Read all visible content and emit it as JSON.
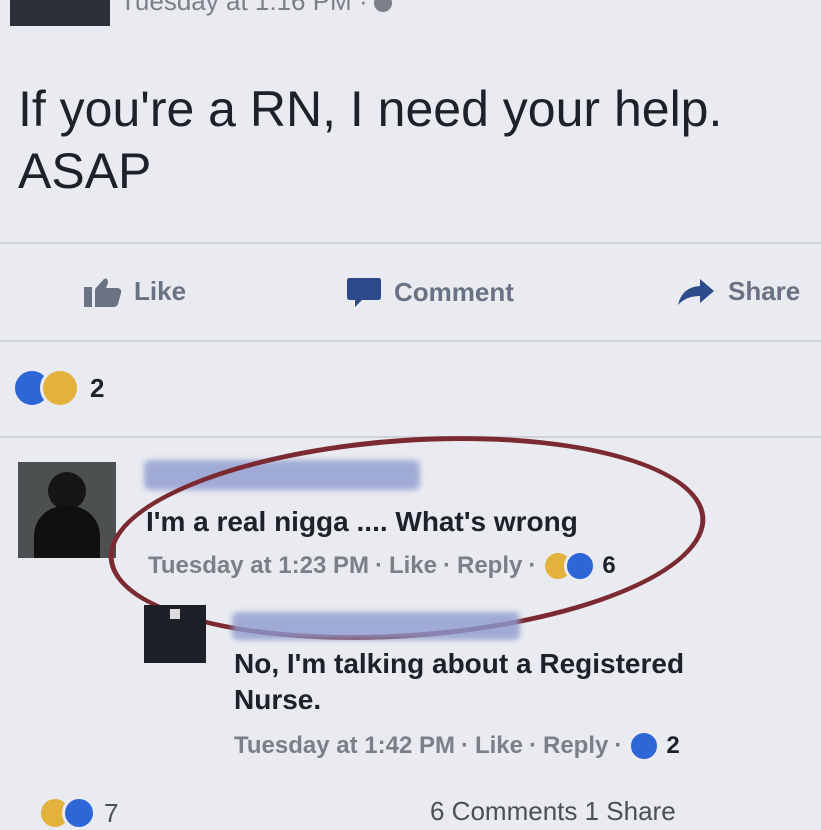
{
  "post": {
    "timestamp": "Tuesday at 1:16 PM ·",
    "text_line1": "If you're a RN, I need your help.",
    "text_line2": "ASAP"
  },
  "actions": {
    "like": "Like",
    "comment": "Comment",
    "share": "Share"
  },
  "reactions": {
    "count": "2"
  },
  "comments": [
    {
      "text": "I'm a real nigga .... What's wrong",
      "time": "Tuesday at 1:23 PM",
      "like": "Like",
      "reply": "Reply",
      "reaction_count": "6"
    },
    {
      "text_line1": "No, I'm talking about a Registered",
      "text_line2": "Nurse.",
      "time": "Tuesday at 1:42 PM",
      "like": "Like",
      "reply": "Reply",
      "reaction_count": "2"
    }
  ],
  "footer": {
    "reaction_count": "7",
    "summary": "6 Comments 1 Share"
  },
  "colors": {
    "background": "#e9ebf0",
    "like_blue": "#2d66d6",
    "haha_yellow": "#e3b23c",
    "action_gray": "#6a7384",
    "circle_annotation": "#7a2a30"
  },
  "icons": [
    "globe-icon",
    "thumbs-up-icon",
    "comment-bubble-icon",
    "share-arrow-icon",
    "like-reaction-icon",
    "haha-reaction-icon"
  ]
}
